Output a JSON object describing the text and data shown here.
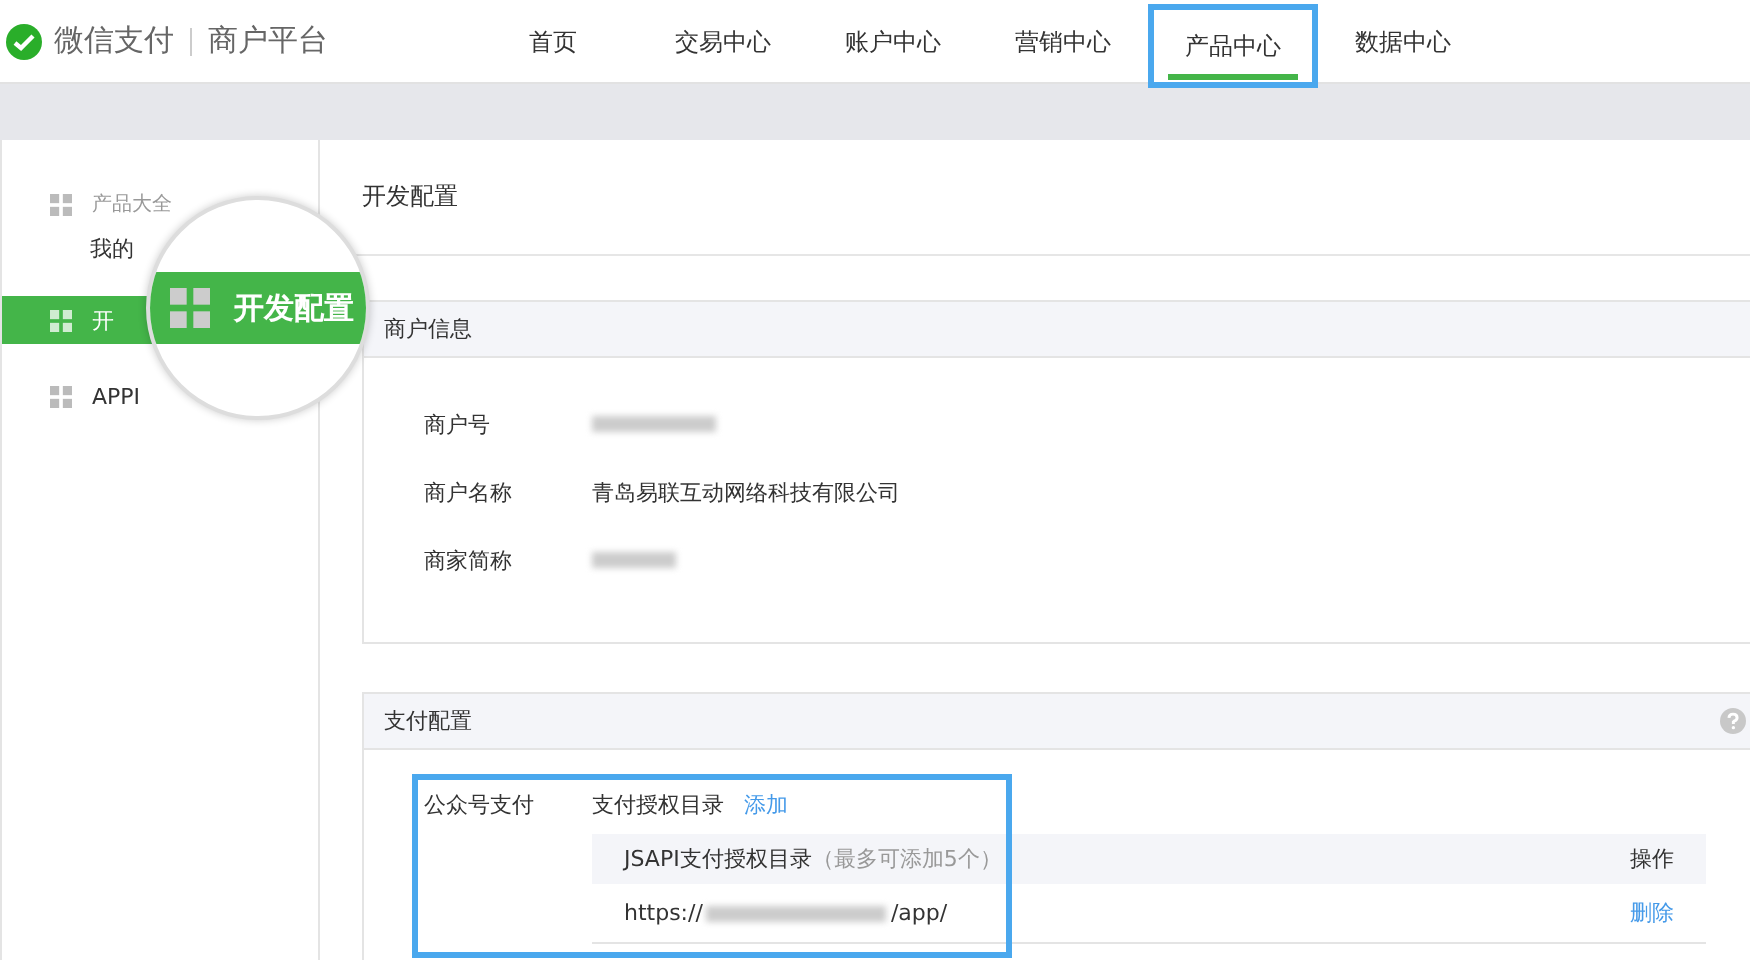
{
  "brand": {
    "name": "微信支付",
    "product": "商户平台"
  },
  "nav": [
    {
      "label": "首页",
      "selected": false,
      "highlighted": false
    },
    {
      "label": "交易中心",
      "selected": false,
      "highlighted": false
    },
    {
      "label": "账户中心",
      "selected": false,
      "highlighted": false
    },
    {
      "label": "营销中心",
      "selected": false,
      "highlighted": false
    },
    {
      "label": "产品中心",
      "selected": true,
      "highlighted": true
    },
    {
      "label": "数据中心",
      "selected": false,
      "highlighted": false
    }
  ],
  "sidebar": {
    "items": [
      {
        "kind": "group",
        "label": "产品大全",
        "selected": false
      },
      {
        "kind": "link",
        "label": "我的",
        "selected": false
      },
      {
        "kind": "group",
        "label": "开",
        "selected": true
      },
      {
        "kind": "group",
        "label": "APPI",
        "selected": false
      }
    ]
  },
  "magnifier": {
    "label": "开发配置"
  },
  "page_title": "开发配置",
  "merchant_info": {
    "title": "商户信息",
    "fields": [
      {
        "label": "商户号",
        "redacted": true
      },
      {
        "label": "商户名称",
        "value": "青岛易联互动网络科技有限公司",
        "redacted": false
      },
      {
        "label": "商家简称",
        "redacted": true
      }
    ]
  },
  "payment_config": {
    "title": "支付配置",
    "sections": [
      {
        "label": "公众号支付",
        "highlighted": true,
        "directory_label": "支付授权目录",
        "add_link": "添加",
        "columns": [
          "JSAPI支付授权目录",
          "操作"
        ],
        "column_note": "（最多可添加5个）",
        "rows": [
          {
            "url_prefix": "https://",
            "url_redacted": true,
            "url_suffix": "/app/",
            "action": "删除"
          }
        ]
      }
    ]
  }
}
